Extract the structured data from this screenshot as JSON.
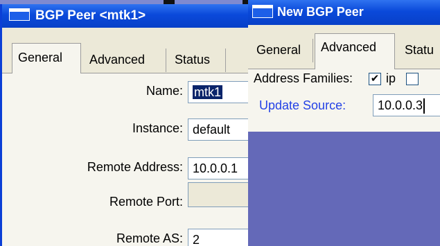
{
  "window_general": {
    "title": "BGP Peer <mtk1>",
    "tabs": [
      {
        "label": "General",
        "active": true
      },
      {
        "label": "Advanced",
        "active": false
      },
      {
        "label": "Status",
        "active": false
      }
    ],
    "fields": {
      "name": {
        "label": "Name:",
        "value": "mtk1"
      },
      "instance": {
        "label": "Instance:",
        "value": "default"
      },
      "remote_address": {
        "label": "Remote Address:",
        "value": "10.0.0.1"
      },
      "remote_port": {
        "label": "Remote Port:",
        "value": ""
      },
      "remote_as": {
        "label": "Remote AS:",
        "value": "2"
      }
    }
  },
  "window_new": {
    "title": "New BGP Peer",
    "tabs": [
      {
        "label": "General",
        "active": false
      },
      {
        "label": "Advanced",
        "active": true
      },
      {
        "label": "Statu",
        "active": false
      }
    ],
    "address_families": {
      "label": "Address Families:",
      "options": [
        {
          "label": "ip",
          "checked": true
        },
        {
          "label": "",
          "checked": false
        }
      ]
    },
    "update_source": {
      "label": "Update Source:",
      "value": "10.0.0.3"
    }
  },
  "colors": {
    "title_bar": "#0a49da",
    "desktop": "#6469b8",
    "accent_label": "#2442e6",
    "selection": "#0a246a"
  },
  "icons": {
    "window": "window-icon",
    "check": "✔"
  }
}
